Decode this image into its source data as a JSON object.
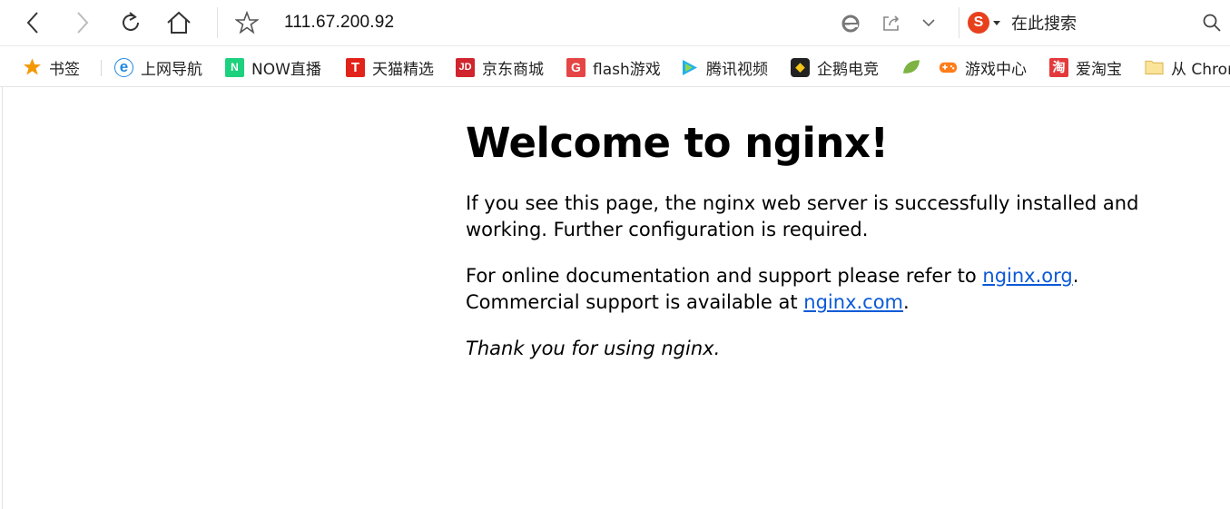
{
  "toolbar": {
    "url": "111.67.200.92",
    "search_label": "在此搜索",
    "search_engine_icon": "sogou-icon"
  },
  "bookmarks": {
    "items": [
      {
        "label": "书签",
        "icon": "star-icon",
        "color": "#f39800"
      },
      {
        "label": "上网导航",
        "icon": "ie-icon",
        "color": "#1e88e5"
      },
      {
        "label": "NOW直播",
        "icon": "now-icon",
        "color": "#1dd17e"
      },
      {
        "label": "天猫精选",
        "icon": "tmall-icon",
        "color": "#e2231a"
      },
      {
        "label": "京东商城",
        "icon": "jd-icon",
        "color": "#d0252e"
      },
      {
        "label": "flash游戏",
        "icon": "flash-icon",
        "color": "#e64545"
      },
      {
        "label": "腾讯视频",
        "icon": "tencent-video-icon",
        "color": "#20b0ee"
      },
      {
        "label": "企鹅电竞",
        "icon": "penguin-esports-icon",
        "color": "#222222"
      },
      {
        "label": "",
        "icon": "leaf-icon",
        "color": "#7cb342"
      },
      {
        "label": "游戏中心",
        "icon": "gamepad-icon",
        "color": "#ff7d1a"
      },
      {
        "label": "爱淘宝",
        "icon": "taobao-icon",
        "color": "#e4393c"
      },
      {
        "label": "从 Chrome",
        "icon": "folder-icon",
        "color": "#f2c660"
      }
    ]
  },
  "page": {
    "heading": "Welcome to nginx!",
    "para1": "If you see this page, the nginx web server is successfully installed and working. Further configuration is required.",
    "para2_prefix": "For online documentation and support please refer to ",
    "link_org": "nginx.org",
    "para2_mid": ".",
    "para2_line2_prefix": "Commercial support is available at ",
    "link_com": "nginx.com",
    "para2_end": ".",
    "thanks": "Thank you for using nginx."
  }
}
